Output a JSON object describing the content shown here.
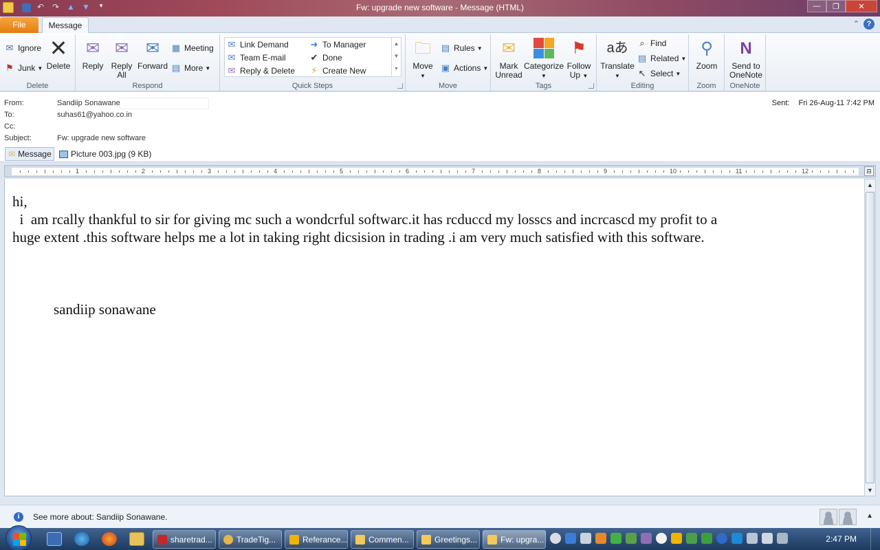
{
  "window": {
    "title": "Fw: upgrade new software  -  Message (HTML)"
  },
  "tabs": {
    "file": "File",
    "message": "Message"
  },
  "ribbon": {
    "delete_group": {
      "label": "Delete",
      "ignore": "Ignore",
      "junk": "Junk",
      "delete": "Delete"
    },
    "respond_group": {
      "label": "Respond",
      "reply": "Reply",
      "reply_all_1": "Reply",
      "reply_all_2": "All",
      "forward": "Forward",
      "meeting": "Meeting",
      "more": "More"
    },
    "quick_steps": {
      "label": "Quick Steps",
      "items": [
        "Link Demand",
        "To Manager",
        "Team E-mail",
        "Done",
        "Reply & Delete",
        "Create New"
      ]
    },
    "move_group": {
      "label": "Move",
      "move": "Move",
      "rules": "Rules",
      "actions": "Actions"
    },
    "tags_group": {
      "label": "Tags",
      "mark_1": "Mark",
      "mark_2": "Unread",
      "categorize": "Categorize",
      "follow_1": "Follow",
      "follow_2": "Up"
    },
    "editing_group": {
      "label": "Editing",
      "translate": "Translate",
      "find": "Find",
      "related": "Related",
      "select": "Select"
    },
    "zoom_group": {
      "label": "Zoom",
      "zoom": "Zoom"
    },
    "onenote_group": {
      "label": "OneNote",
      "send_1": "Send to",
      "send_2": "OneNote"
    }
  },
  "header": {
    "from_label": "From:",
    "from_value": "Sandiip Sonawane",
    "to_label": "To:",
    "to_value": "suhas61@yahoo.co.in",
    "cc_label": "Cc:",
    "cc_value": "",
    "subject_label": "Subject:",
    "subject_value": "Fw: upgrade new software",
    "sent_label": "Sent:",
    "sent_value": "Fri 26-Aug-11 7:42 PM"
  },
  "attachments": {
    "message_tab": "Message",
    "file": "Picture 003.jpg (9 KB)"
  },
  "ruler": {
    "numbers": [
      "1",
      "2",
      "3",
      "4",
      "5",
      "6",
      "7",
      "8",
      "9",
      "10",
      "11",
      "12"
    ]
  },
  "body": {
    "greeting": "hi,",
    "line1": "  i  am rcally thankful to sir for giving mc such a wondcrful softwarc.it has rcduccd my losscs and incrcascd my profit to a",
    "line2": "huge extent .this software helps me a lot in taking right dicsision in trading .i am very much satisfied with this software.",
    "signature": "sandiip sonawane"
  },
  "people_pane": {
    "text": "See more about: Sandiip Sonawane."
  },
  "taskbar": {
    "buttons": [
      "sharetrad...",
      "TradeTig...",
      "Referance...",
      "Commen...",
      "Greetings...",
      "Fw: upgra..."
    ],
    "clock": "2:47 PM"
  },
  "colors": {
    "file_tab": "#e37e10",
    "accent_blue": "#2f6bc7",
    "taskbar": "#1d3a5f"
  }
}
